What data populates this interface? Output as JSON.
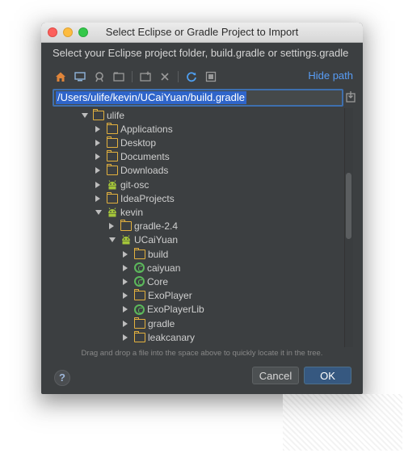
{
  "window": {
    "title": "Select Eclipse or Gradle Project to Import"
  },
  "subtitle": "Select your Eclipse project folder, build.gradle or settings.gradle",
  "toolbar": {
    "icons": [
      "home-icon",
      "desktop-icon",
      "project-icon",
      "module-icon",
      "new-folder-icon",
      "delete-icon",
      "refresh-icon",
      "show-hidden-icon"
    ],
    "hide_path_label": "Hide path"
  },
  "path": {
    "value": "/Users/ulife/kevin/UCaiYuan/build.gradle"
  },
  "tree": [
    {
      "label": "ulife",
      "depth": 0,
      "icon": "folder",
      "expanded": true
    },
    {
      "label": "Applications",
      "depth": 1,
      "icon": "folder",
      "expanded": false
    },
    {
      "label": "Desktop",
      "depth": 1,
      "icon": "folder",
      "expanded": false
    },
    {
      "label": "Documents",
      "depth": 1,
      "icon": "folder",
      "expanded": false
    },
    {
      "label": "Downloads",
      "depth": 1,
      "icon": "folder",
      "expanded": false
    },
    {
      "label": "git-osc",
      "depth": 1,
      "icon": "android",
      "expanded": false
    },
    {
      "label": "IdeaProjects",
      "depth": 1,
      "icon": "folder",
      "expanded": false
    },
    {
      "label": "kevin",
      "depth": 1,
      "icon": "android",
      "expanded": true
    },
    {
      "label": "gradle-2.4",
      "depth": 2,
      "icon": "folder",
      "expanded": false
    },
    {
      "label": "UCaiYuan",
      "depth": 2,
      "icon": "android",
      "expanded": true
    },
    {
      "label": "build",
      "depth": 3,
      "icon": "folder",
      "expanded": false
    },
    {
      "label": "caiyuan",
      "depth": 3,
      "icon": "module",
      "expanded": false
    },
    {
      "label": "Core",
      "depth": 3,
      "icon": "module",
      "expanded": false
    },
    {
      "label": "ExoPlayer",
      "depth": 3,
      "icon": "folder",
      "expanded": false
    },
    {
      "label": "ExoPlayerLib",
      "depth": 3,
      "icon": "module",
      "expanded": false
    },
    {
      "label": "gradle",
      "depth": 3,
      "icon": "folder",
      "expanded": false
    },
    {
      "label": "leakcanary",
      "depth": 3,
      "icon": "folder",
      "expanded": false
    }
  ],
  "hint": "Drag and drop a file into the space above to quickly locate it in the tree.",
  "buttons": {
    "cancel": "Cancel",
    "ok": "OK",
    "help": "?"
  },
  "colors": {
    "accent": "#589df6",
    "ok_button": "#365880",
    "folder": "#e3b13e",
    "android": "#a4c639",
    "module": "#5cb85c"
  }
}
